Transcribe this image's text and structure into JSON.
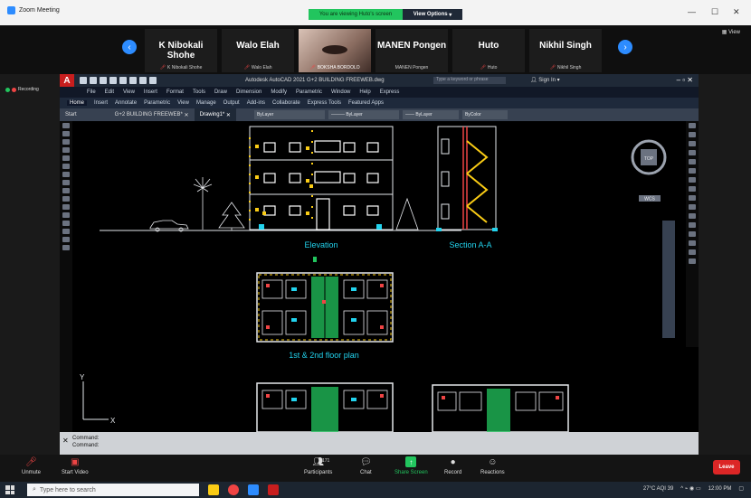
{
  "zoom": {
    "window_title": "Zoom Meeting",
    "share_banner": "You are viewing Huto's screen",
    "view_options": "View Options",
    "view_button": "View",
    "participants": [
      {
        "big": "K Nibokali Shohe",
        "small": "K Nibokali Shohe"
      },
      {
        "big": "Walo Elah",
        "small": "Walo Elah"
      },
      {
        "big": "",
        "small": "BOKSHA BORDOLO"
      },
      {
        "big": "MANEN Pongen",
        "small": "MANEN Pongen"
      },
      {
        "big": "Huto",
        "small": "Huto"
      },
      {
        "big": "Nikhil Singh",
        "small": "Nikhil Singh"
      }
    ],
    "recording": "Recording",
    "bottom": {
      "unmute": "Unmute",
      "start_video": "Start Video",
      "participants": "Participants",
      "participants_count": "171",
      "chat": "Chat",
      "share_screen": "Share Screen",
      "record": "Record",
      "reactions": "Reactions",
      "leave": "Leave"
    }
  },
  "acad": {
    "title": "Autodesk AutoCAD 2021   G+2 BUILDING FREEWEB.dwg",
    "search_placeholder": "Type a keyword or phrase",
    "signin": "Sign In",
    "menu": [
      "File",
      "Edit",
      "View",
      "Insert",
      "Format",
      "Tools",
      "Draw",
      "Dimension",
      "Modify",
      "Parametric",
      "Window",
      "Help",
      "Express"
    ],
    "ribbon_tabs": [
      "Home",
      "Insert",
      "Annotate",
      "Parametric",
      "View",
      "Manage",
      "Output",
      "Add-ins",
      "Collaborate",
      "Express Tools",
      "Featured Apps"
    ],
    "file_tabs": [
      "Start",
      "G+2 BUILDING FREEWEB*",
      "Drawing1*"
    ],
    "layers": [
      "ByLayer",
      "ByLayer",
      "ByLayer",
      "ByColor"
    ],
    "labels": {
      "elevation": "Elevation",
      "section": "Section A-A",
      "floor_plan": "1st & 2nd floor plan",
      "viewcube_top": "TOP",
      "viewcube_wcs": "WCS",
      "axis_y": "Y",
      "axis_x": "X"
    },
    "command": [
      "Command:",
      "Command:"
    ]
  },
  "taskbar": {
    "search": "Type here to search",
    "weather": "27°C  AQI 39",
    "time": "12:00 PM"
  },
  "colors": {
    "zoom_blue": "#2d8cff",
    "share_green": "#22c55e",
    "leave_red": "#dc2626",
    "cad_yellow": "#facc15",
    "cad_cyan": "#22d3ee",
    "cad_green": "#22c55e"
  }
}
